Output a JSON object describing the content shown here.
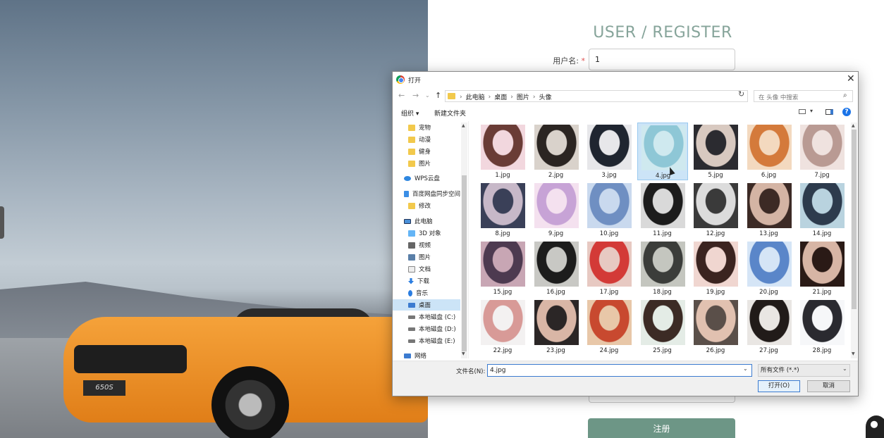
{
  "register": {
    "title": "USER / REGISTER",
    "username_label": "用户名:",
    "required_mark": "*",
    "username_value": "1",
    "submit_label": "注册"
  },
  "photo": {
    "plate_text": "650S"
  },
  "dialog": {
    "title": "打开",
    "breadcrumbs": [
      "此电脑",
      "桌面",
      "图片",
      "头像"
    ],
    "search_placeholder": "在 头像 中搜索",
    "organize_label": "组织 ▾",
    "new_folder_label": "新建文件夹",
    "help_label": "?",
    "nav_items": [
      {
        "label": "宠物",
        "icon": "folder-icon",
        "indent": true
      },
      {
        "label": "动漫",
        "icon": "folder-icon",
        "indent": true
      },
      {
        "label": "健身",
        "icon": "folder-icon",
        "indent": true
      },
      {
        "label": "图片",
        "icon": "folder-icon",
        "indent": true
      },
      {
        "label": "WPS云盘",
        "icon": "cloud-icon",
        "indent": false
      },
      {
        "label": "百度网盘同步空间",
        "icon": "baidu-sync-icon",
        "indent": false
      },
      {
        "label": "修改",
        "icon": "folder-icon",
        "indent": true
      },
      {
        "label": "此电脑",
        "icon": "computer-icon",
        "indent": false
      },
      {
        "label": "3D 对象",
        "icon": "3d-objects-icon",
        "indent": true
      },
      {
        "label": "视频",
        "icon": "video-icon",
        "indent": true
      },
      {
        "label": "图片",
        "icon": "pictures-icon",
        "indent": true
      },
      {
        "label": "文档",
        "icon": "document-icon",
        "indent": true
      },
      {
        "label": "下载",
        "icon": "download-icon",
        "indent": true
      },
      {
        "label": "音乐",
        "icon": "music-icon",
        "indent": true
      },
      {
        "label": "桌面",
        "icon": "desktop-icon",
        "indent": true,
        "selected": true
      },
      {
        "label": "本地磁盘 (C:)",
        "icon": "disk-icon",
        "indent": true
      },
      {
        "label": "本地磁盘 (D:)",
        "icon": "disk-icon",
        "indent": true
      },
      {
        "label": "本地磁盘 (E:)",
        "icon": "disk-icon",
        "indent": true
      },
      {
        "label": "网络",
        "icon": "network-icon",
        "indent": false
      }
    ],
    "files": [
      {
        "name": "1.jpg",
        "colors": [
          "#f2d7de",
          "#6a3c36"
        ]
      },
      {
        "name": "2.jpg",
        "colors": [
          "#d9d2cb",
          "#2b2522"
        ]
      },
      {
        "name": "3.jpg",
        "colors": [
          "#e7e7ea",
          "#1f2530"
        ]
      },
      {
        "name": "4.jpg",
        "colors": [
          "#cfe9ef",
          "#8ec7d6"
        ],
        "selected": true
      },
      {
        "name": "5.jpg",
        "colors": [
          "#2b2b30",
          "#d8c9c0"
        ]
      },
      {
        "name": "6.jpg",
        "colors": [
          "#f3d9bf",
          "#d47a3b"
        ]
      },
      {
        "name": "7.jpg",
        "colors": [
          "#efe2df",
          "#b99a93"
        ]
      },
      {
        "name": "8.jpg",
        "colors": [
          "#3a4058",
          "#c7b8c8"
        ]
      },
      {
        "name": "9.jpg",
        "colors": [
          "#f4e1ef",
          "#c7a3d6"
        ]
      },
      {
        "name": "10.jpg",
        "colors": [
          "#c9d9ee",
          "#6f8fc2"
        ]
      },
      {
        "name": "11.jpg",
        "colors": [
          "#d9d9d9",
          "#1c1c1c"
        ]
      },
      {
        "name": "12.jpg",
        "colors": [
          "#3a3a3a",
          "#dcdcdc"
        ]
      },
      {
        "name": "13.jpg",
        "colors": [
          "#3c2a25",
          "#d4b4a4"
        ]
      },
      {
        "name": "14.jpg",
        "colors": [
          "#b9d3df",
          "#2d3b4d"
        ]
      },
      {
        "name": "15.jpg",
        "colors": [
          "#c8a6b4",
          "#4d3a50"
        ]
      },
      {
        "name": "16.jpg",
        "colors": [
          "#c8c8c4",
          "#1c1c1c"
        ]
      },
      {
        "name": "17.jpg",
        "colors": [
          "#e7c9c2",
          "#d33a37"
        ]
      },
      {
        "name": "18.jpg",
        "colors": [
          "#c4c6bf",
          "#3b3d3a"
        ]
      },
      {
        "name": "19.jpg",
        "colors": [
          "#f0d6d0",
          "#3b2420"
        ]
      },
      {
        "name": "20.jpg",
        "colors": [
          "#d5e5f6",
          "#5a86c9"
        ]
      },
      {
        "name": "21.jpg",
        "colors": [
          "#2a1a16",
          "#d7b5a5"
        ]
      },
      {
        "name": "22.jpg",
        "colors": [
          "#f3f1f1",
          "#d89a97"
        ]
      },
      {
        "name": "23.jpg",
        "colors": [
          "#2b2626",
          "#d9b6a6"
        ]
      },
      {
        "name": "24.jpg",
        "colors": [
          "#e8c7a8",
          "#c8492f"
        ]
      },
      {
        "name": "25.jpg",
        "colors": [
          "#e4ece6",
          "#3c2b25"
        ]
      },
      {
        "name": "26.jpg",
        "colors": [
          "#5a4f49",
          "#e1c1b0"
        ]
      },
      {
        "name": "27.jpg",
        "colors": [
          "#e9e6e3",
          "#211b19"
        ]
      },
      {
        "name": "28.jpg",
        "colors": [
          "#f6f7f9",
          "#2a2a30"
        ]
      }
    ],
    "filename_label": "文件名(N):",
    "filename_value": "4.jpg",
    "filetype_value": "所有文件 (*.*)",
    "open_label": "打开(O)",
    "cancel_label": "取消"
  }
}
